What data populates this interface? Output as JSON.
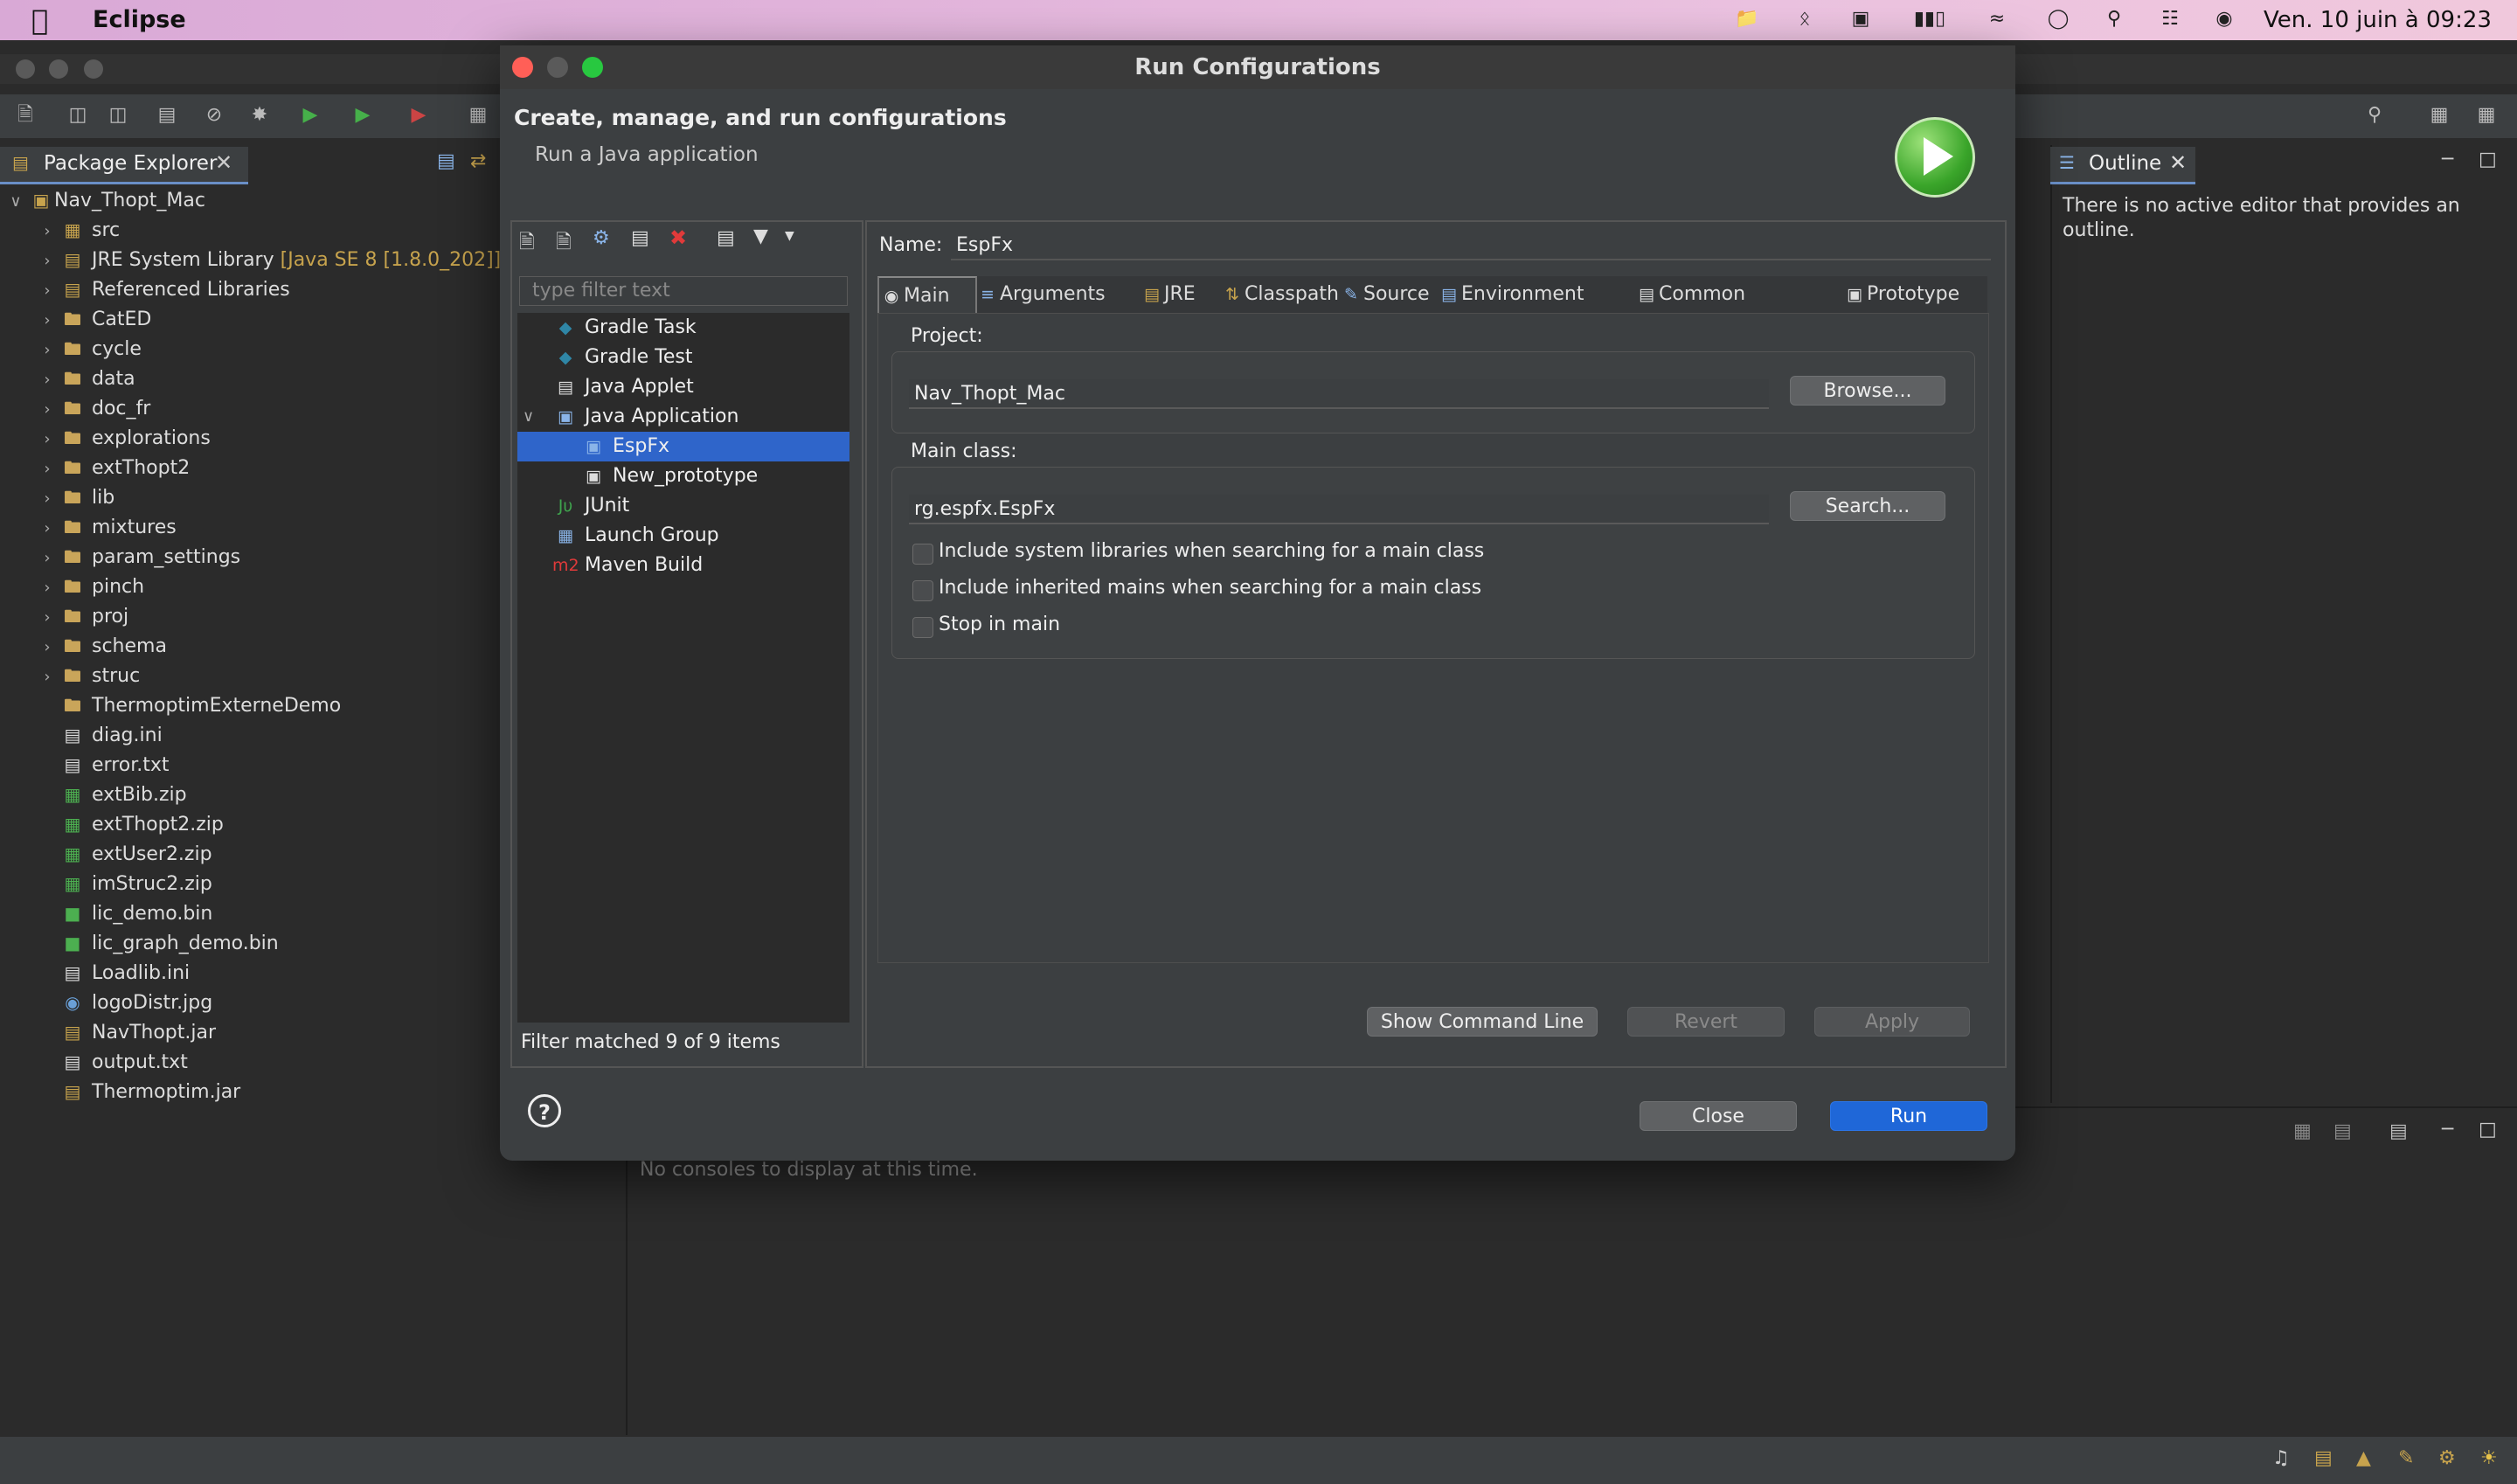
{
  "menubar": {
    "app_name": "Eclipse",
    "clock": "Ven. 10 juin à  09:23"
  },
  "package_explorer": {
    "tab_label": "Package Explorer",
    "project": "Nav_Thopt_Mac",
    "items": [
      {
        "label": "src",
        "icon": "source-folder-icon",
        "expandable": true
      },
      {
        "label": "JRE System Library",
        "decoration": "[Java SE 8 [1.8.0_202]]",
        "icon": "library-icon",
        "expandable": true
      },
      {
        "label": "Referenced Libraries",
        "icon": "library-icon",
        "expandable": true
      },
      {
        "label": "CatED",
        "icon": "folder-icon",
        "expandable": true
      },
      {
        "label": "cycle",
        "icon": "folder-icon",
        "expandable": true
      },
      {
        "label": "data",
        "icon": "folder-icon",
        "expandable": true
      },
      {
        "label": "doc_fr",
        "icon": "folder-icon",
        "expandable": true
      },
      {
        "label": "explorations",
        "icon": "folder-icon",
        "expandable": true
      },
      {
        "label": "extThopt2",
        "icon": "folder-icon",
        "expandable": true
      },
      {
        "label": "lib",
        "icon": "folder-icon",
        "expandable": true
      },
      {
        "label": "mixtures",
        "icon": "folder-icon",
        "expandable": true
      },
      {
        "label": "param_settings",
        "icon": "folder-icon",
        "expandable": true
      },
      {
        "label": "pinch",
        "icon": "folder-icon",
        "expandable": true
      },
      {
        "label": "proj",
        "icon": "folder-icon",
        "expandable": true
      },
      {
        "label": "schema",
        "icon": "folder-icon",
        "expandable": true
      },
      {
        "label": "struc",
        "icon": "folder-icon",
        "expandable": true
      },
      {
        "label": "ThermoptimExterneDemo",
        "icon": "folder-icon",
        "expandable": false
      },
      {
        "label": "diag.ini",
        "icon": "file-icon",
        "expandable": false
      },
      {
        "label": "error.txt",
        "icon": "file-icon",
        "expandable": false
      },
      {
        "label": "extBib.zip",
        "icon": "archive-icon",
        "expandable": false
      },
      {
        "label": "extThopt2.zip",
        "icon": "archive-icon",
        "expandable": false
      },
      {
        "label": "extUser2.zip",
        "icon": "archive-icon",
        "expandable": false
      },
      {
        "label": "imStruc2.zip",
        "icon": "archive-icon",
        "expandable": false
      },
      {
        "label": "lic_demo.bin",
        "icon": "binary-icon",
        "expandable": false
      },
      {
        "label": "lic_graph_demo.bin",
        "icon": "binary-icon",
        "expandable": false
      },
      {
        "label": "Loadlib.ini",
        "icon": "file-icon",
        "expandable": false
      },
      {
        "label": "logoDistr.jpg",
        "icon": "image-icon",
        "expandable": false
      },
      {
        "label": "NavThopt.jar",
        "icon": "jar-icon",
        "expandable": false
      },
      {
        "label": "output.txt",
        "icon": "file-icon",
        "expandable": false
      },
      {
        "label": "Thermoptim.jar",
        "icon": "jar-icon",
        "expandable": false
      }
    ]
  },
  "outline": {
    "tab_label": "Outline",
    "message": "There is no active editor that provides an outline."
  },
  "console": {
    "message": "No consoles to display at this time."
  },
  "dialog": {
    "title": "Run Configurations",
    "header_title": "Create, manage, and run configurations",
    "header_subtitle": "Run a Java application",
    "filter_placeholder": "type filter text",
    "config_tree": [
      {
        "label": "Gradle Task",
        "icon": "gradle-icon",
        "level": 0
      },
      {
        "label": "Gradle Test",
        "icon": "gradle-icon",
        "level": 0
      },
      {
        "label": "Java Applet",
        "icon": "applet-icon",
        "level": 0
      },
      {
        "label": "Java Application",
        "icon": "java-app-icon",
        "level": 0,
        "expanded": true
      },
      {
        "label": "EspFx",
        "icon": "java-app-icon",
        "level": 1,
        "selected": true
      },
      {
        "label": "New_prototype",
        "icon": "prototype-icon",
        "level": 1
      },
      {
        "label": "JUnit",
        "icon": "junit-icon",
        "level": 0
      },
      {
        "label": "Launch Group",
        "icon": "launch-group-icon",
        "level": 0
      },
      {
        "label": "Maven Build",
        "icon": "maven-icon",
        "level": 0
      }
    ],
    "filter_status": "Filter matched 9 of 9 items",
    "name_label": "Name:",
    "name_value": "EspFx",
    "tabs": [
      {
        "label": "Main",
        "icon": "main-tab-icon",
        "active": true
      },
      {
        "label": "Arguments",
        "icon": "arguments-icon"
      },
      {
        "label": "JRE",
        "icon": "jre-icon"
      },
      {
        "label": "Classpath",
        "icon": "classpath-icon"
      },
      {
        "label": "Source",
        "icon": "source-icon"
      },
      {
        "label": "Environment",
        "icon": "environment-icon"
      },
      {
        "label": "Common",
        "icon": "common-icon"
      },
      {
        "label": "Prototype",
        "icon": "prototype-icon"
      }
    ],
    "project_label": "Project:",
    "project_value": "Nav_Thopt_Mac",
    "browse_label": "Browse...",
    "main_class_label": "Main class:",
    "main_class_value": "rg.espfx.EspFx",
    "search_label": "Search...",
    "checkboxes": [
      {
        "label": "Include system libraries when searching for a main class",
        "checked": false
      },
      {
        "label": "Include inherited mains when searching for a main class",
        "checked": false
      },
      {
        "label": "Stop in main",
        "checked": false
      }
    ],
    "show_cmd_label": "Show Command Line",
    "revert_label": "Revert",
    "apply_label": "Apply",
    "close_label": "Close",
    "run_label": "Run",
    "help_glyph": "?"
  },
  "colors": {
    "selection": "#2f65ca",
    "primary_button": "#1f67d8",
    "close_dot": "#ff5f57",
    "minimize_dot": "#5a5a5a",
    "zoom_dot": "#28c840"
  }
}
